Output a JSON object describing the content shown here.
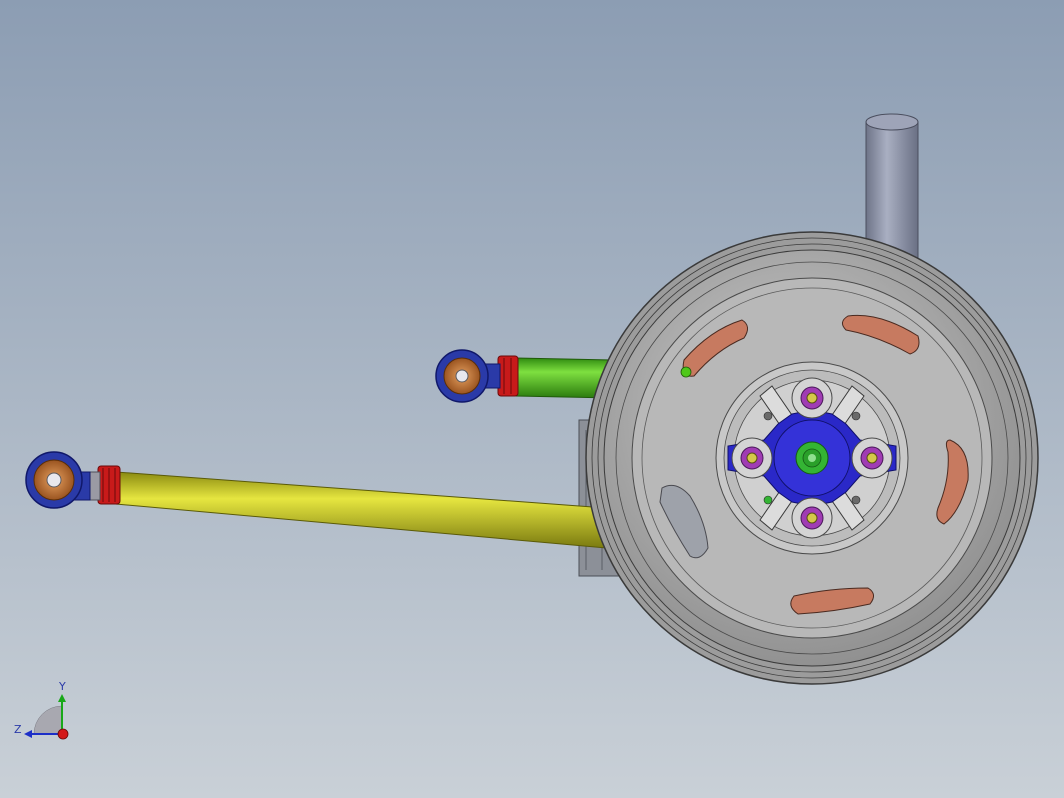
{
  "viewport": {
    "background_top": "#8c9db3",
    "background_bottom": "#c9d0d7"
  },
  "triad": {
    "y_label": "Y",
    "z_label": "Z",
    "y_color": "#18a818",
    "z_color": "#1c2fc8",
    "x_color": "#d41818"
  },
  "parts": {
    "upper_link_color": "#4fc81a",
    "lower_link_color": "#c8c81a",
    "rod_end_color": "#2a3aa8",
    "bearing_color": "#c87a30",
    "jam_nut_color": "#c81a1a",
    "wheel_color": "#a8a8a8",
    "hub_color": "#2a28c8",
    "spindle_color": "#34b434",
    "lug_color": "#a03cb4",
    "window_color": "#c77a60",
    "shock_color": "#8e94aa"
  }
}
